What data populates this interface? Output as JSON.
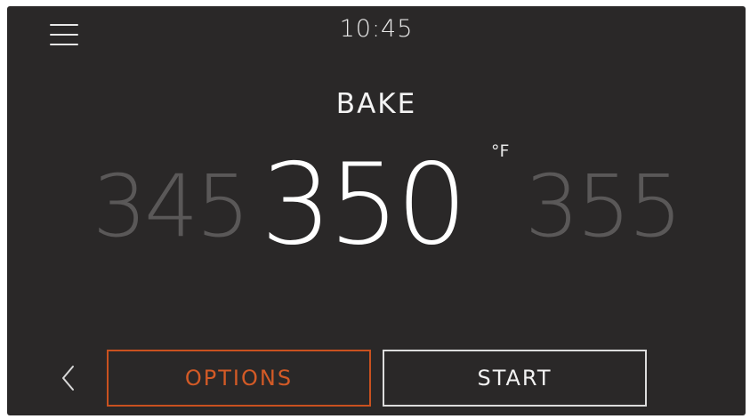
{
  "header": {
    "time": "10:45",
    "menu_icon": "hamburger-menu-icon"
  },
  "mode": {
    "title": "BAKE"
  },
  "temperature": {
    "previous": "345",
    "current": "350",
    "next": "355",
    "unit": "°F"
  },
  "footer": {
    "back_icon": "chevron-left-icon",
    "options_label": "OPTIONS",
    "start_label": "START"
  },
  "colors": {
    "background": "#2a2828",
    "accent": "#d35a26",
    "text": "#f2f2f2",
    "dim_text": "#5a5858"
  }
}
